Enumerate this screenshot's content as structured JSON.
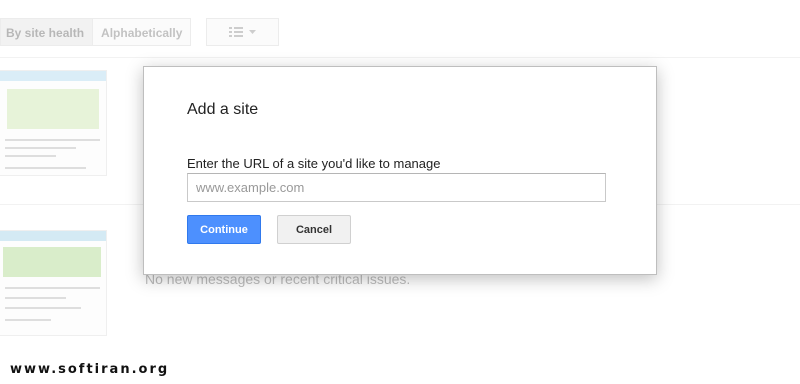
{
  "toolbar": {
    "sort_by_health": "By site health",
    "sort_alpha": "Alphabetically",
    "view_icon": "list-view-icon"
  },
  "background": {
    "message": "No new messages or recent critical issues."
  },
  "dialog": {
    "title": "Add a site",
    "url_label": "Enter the URL of a site you'd like to manage",
    "url_placeholder": "www.example.com",
    "url_value": "",
    "continue_label": "Continue",
    "cancel_label": "Cancel"
  },
  "watermark": "www.softiran.org",
  "colors": {
    "primary_button": "#4d90fe",
    "secondary_button": "#f1f1f1"
  }
}
